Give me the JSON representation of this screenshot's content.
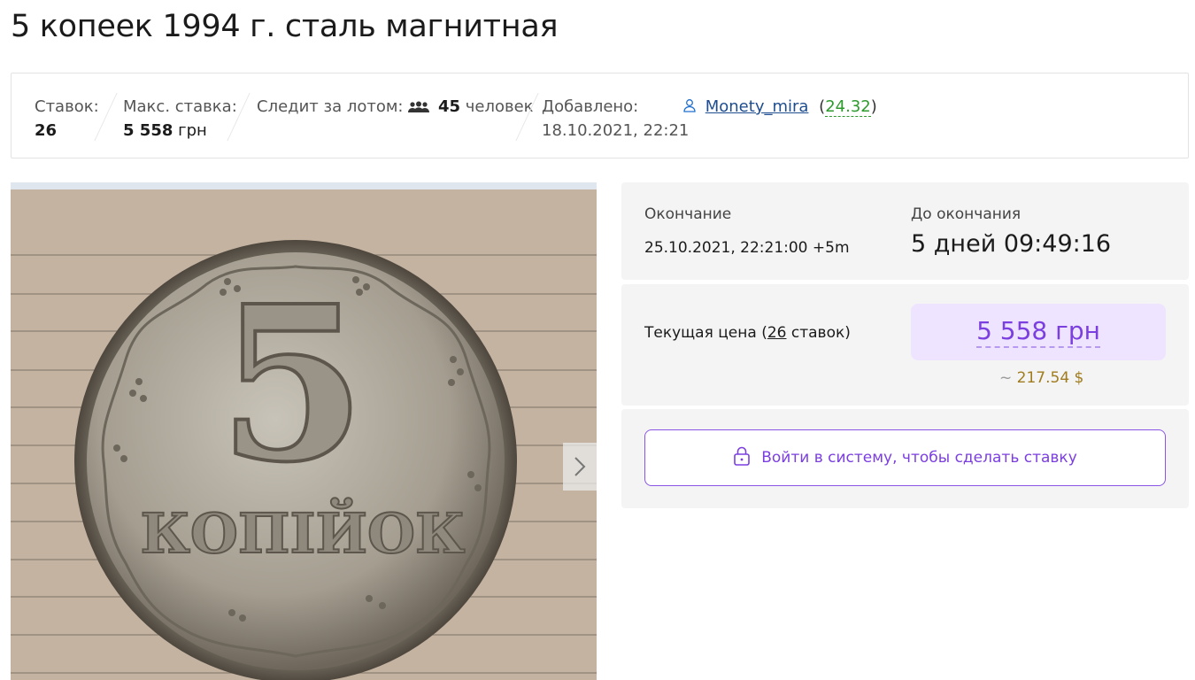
{
  "page": {
    "title": "5 копеек 1994 г. сталь магнитная"
  },
  "stats": {
    "bids_label": "Ставок:",
    "bids_value": "26",
    "max_bid_label": "Макс. ставка:",
    "max_bid_value": "5 558",
    "max_bid_unit": "грн",
    "watchers_label": "Следит за лотом:",
    "watchers_icon": "people-icon",
    "watchers_count": "45",
    "watchers_unit": "человек",
    "added_label": "Добавлено:",
    "added_value": "18.10.2021, 22:21",
    "seller_icon": "user-icon",
    "seller_name": "Monety_mira",
    "seller_rating": "24.32",
    "paren_open": "(",
    "paren_close": ")"
  },
  "gallery": {
    "next_icon": "chevron-right-icon",
    "image": "coin 5 kopiyok photo"
  },
  "auction": {
    "end_label": "Окончание",
    "end_value": "25.10.2021, 22:21:00 +5m",
    "remaining_label": "До окончания",
    "remaining_value": "5 дней 09:49:16",
    "current_price_label": "Текущая цена (",
    "bid_count": "26",
    "bid_suffix": " ставок)",
    "price": "5 558 грн",
    "usd_tilde": "~",
    "usd_value": "217.54 $",
    "login_icon": "lock-icon",
    "login_label": "Войти в систему, чтобы сделать ставку"
  },
  "colors": {
    "accent": "#7b3fe0",
    "price_bg": "#efe4ff",
    "panel_bg": "#f4f4f4",
    "usd": "#a07c1e",
    "rating": "#2e9a2e",
    "link": "#1e4d8f"
  }
}
